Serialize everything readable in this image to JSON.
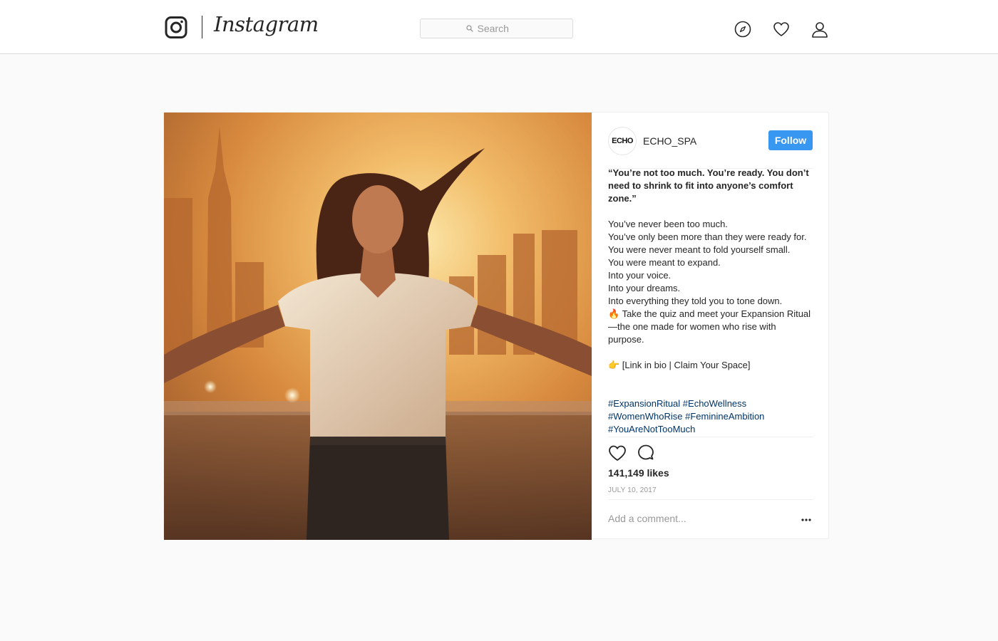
{
  "app": {
    "wordmark": "Instagram"
  },
  "header": {
    "search_placeholder": "Search",
    "nav_icons": [
      "compass-icon",
      "heart-icon",
      "profile-icon"
    ]
  },
  "post": {
    "avatar_text": "ECHO",
    "username": "ECHO_SPA",
    "follow_label": "Follow",
    "caption_quote": "“You’re not too much. You’re ready. You don’t need to shrink to fit into anyone’s comfort zone.”",
    "caption_body": "You’ve never been too much.\nYou’ve only been more than they were ready for.\nYou were never meant to fold yourself small.\nYou were meant to expand.\nInto your voice.\nInto your dreams.\nInto everything they told you to tone down.\n🔥 Take the quiz and meet your Expansion Ritual—the one made for women who rise with purpose.\n\n👉 [Link in bio | Claim Your Space]",
    "hashtags": "#ExpansionRitual #EchoWellness #WomenWhoRise #FeminineAmbition #YouAreNotTooMuch",
    "likes": "141,149 likes",
    "date": "JULY 10, 2017",
    "comment_placeholder": "Add a comment..."
  },
  "colors": {
    "accent": "#3897f0",
    "hashtag": "#003569",
    "border": "#dbdbdb",
    "background": "#fafafa"
  }
}
